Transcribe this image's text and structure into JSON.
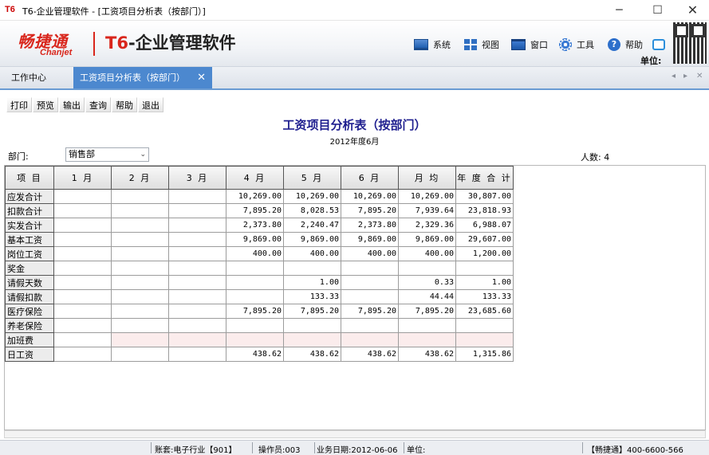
{
  "window": {
    "app_icon": "T6",
    "title": "T6-企业管理软件 - [工资项目分析表（按部门）]",
    "minimize": "─",
    "maximize": "☐",
    "close": "✕"
  },
  "banner": {
    "brand_cn": "畅捷通",
    "brand_en": "Chanjet",
    "product_prefix": "T6",
    "product_name": "-企业管理软件",
    "menu": [
      {
        "label": "系统",
        "icon": "system-icon"
      },
      {
        "label": "视图",
        "icon": "view-icon"
      },
      {
        "label": "窗口",
        "icon": "window-icon"
      },
      {
        "label": "工具",
        "icon": "tools-icon"
      },
      {
        "label": "帮助",
        "icon": "help-icon"
      }
    ],
    "help_glyph": "?",
    "unit_label": "单位:"
  },
  "tabs": {
    "home": "工作中心",
    "active": "工资项目分析表（按部门）",
    "active_close": "✕",
    "nav_prev": "◂",
    "nav_next": "▸",
    "nav_close": "✕"
  },
  "toolbar": {
    "print": "打印",
    "preview": "预览",
    "export": "输出",
    "query": "查询",
    "help": "帮助",
    "exit": "退出"
  },
  "report": {
    "title": "工资项目分析表（按部门）",
    "period": "2012年度6月",
    "dept_label": "部门:",
    "dept_value": "销售部",
    "headcount": "人数: 4"
  },
  "grid": {
    "columns": [
      "项 目",
      "1 月",
      "2 月",
      "3 月",
      "4 月",
      "5 月",
      "6 月",
      "月 均",
      "年 度 合 计"
    ],
    "rows": [
      {
        "item": "应发合计",
        "m1": "",
        "m2": "",
        "m3": "",
        "m4": "10,269.00",
        "m5": "10,269.00",
        "m6": "10,269.00",
        "avg": "10,269.00",
        "total": "30,807.00"
      },
      {
        "item": "扣款合计",
        "m1": "",
        "m2": "",
        "m3": "",
        "m4": "7,895.20",
        "m5": "8,028.53",
        "m6": "7,895.20",
        "avg": "7,939.64",
        "total": "23,818.93"
      },
      {
        "item": "实发合计",
        "m1": "",
        "m2": "",
        "m3": "",
        "m4": "2,373.80",
        "m5": "2,240.47",
        "m6": "2,373.80",
        "avg": "2,329.36",
        "total": "6,988.07"
      },
      {
        "item": "基本工资",
        "m1": "",
        "m2": "",
        "m3": "",
        "m4": "9,869.00",
        "m5": "9,869.00",
        "m6": "9,869.00",
        "avg": "9,869.00",
        "total": "29,607.00"
      },
      {
        "item": "岗位工资",
        "m1": "",
        "m2": "",
        "m3": "",
        "m4": "400.00",
        "m5": "400.00",
        "m6": "400.00",
        "avg": "400.00",
        "total": "1,200.00"
      },
      {
        "item": "奖金",
        "m1": "",
        "m2": "",
        "m3": "",
        "m4": "",
        "m5": "",
        "m6": "",
        "avg": "",
        "total": ""
      },
      {
        "item": "请假天数",
        "m1": "",
        "m2": "",
        "m3": "",
        "m4": "",
        "m5": "1.00",
        "m6": "",
        "avg": "0.33",
        "total": "1.00"
      },
      {
        "item": "请假扣款",
        "m1": "",
        "m2": "",
        "m3": "",
        "m4": "",
        "m5": "133.33",
        "m6": "",
        "avg": "44.44",
        "total": "133.33"
      },
      {
        "item": "医疗保险",
        "m1": "",
        "m2": "",
        "m3": "",
        "m4": "7,895.20",
        "m5": "7,895.20",
        "m6": "7,895.20",
        "avg": "7,895.20",
        "total": "23,685.60"
      },
      {
        "item": "养老保险",
        "m1": "",
        "m2": "",
        "m3": "",
        "m4": "",
        "m5": "",
        "m6": "",
        "avg": "",
        "total": ""
      },
      {
        "item": "加班费",
        "m1": "",
        "m2": "",
        "m3": "",
        "m4": "",
        "m5": "",
        "m6": "",
        "avg": "",
        "total": ""
      },
      {
        "item": "日工资",
        "m1": "",
        "m2": "",
        "m3": "",
        "m4": "438.62",
        "m5": "438.62",
        "m6": "438.62",
        "avg": "438.62",
        "total": "1,315.86"
      }
    ]
  },
  "status": {
    "account": "账套:电子行业【901】",
    "operator": "操作员:003",
    "business_date": "业务日期:2012-06-06",
    "unit": "单位:",
    "hotline": "【畅捷通】400-6600-566"
  }
}
